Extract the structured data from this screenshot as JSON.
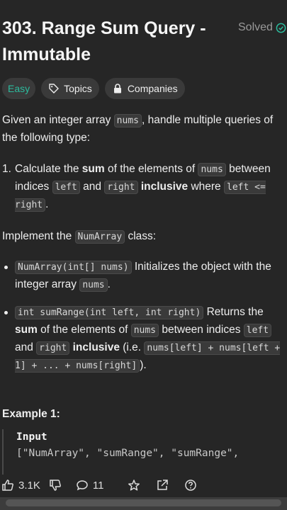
{
  "problem": {
    "title": "303. Range Sum Query - Immutable",
    "status": "Solved",
    "difficulty": "Easy",
    "topics_label": "Topics",
    "companies_label": "Companies"
  },
  "description": {
    "intro_1": "Given an integer array ",
    "intro_code": "nums",
    "intro_2": ", handle multiple queries of the following type:",
    "item1": {
      "num": "1.",
      "t1": "Calculate the ",
      "b1": "sum",
      "t2": " of the elements of ",
      "c1": "nums",
      "t3": " between indices ",
      "c2": "left",
      "t4": " and ",
      "c3": "right",
      "t5": " ",
      "b2": "inclusive",
      "t6": " where ",
      "c4": "left <= right",
      "t7": "."
    },
    "impl_1": "Implement the ",
    "impl_code": "NumArray",
    "impl_2": " class:",
    "bullet1": {
      "c1": "NumArray(int[] nums)",
      "t1": " Initializes the object with the integer array ",
      "c2": "nums",
      "t2": "."
    },
    "bullet2": {
      "c1": "int sumRange(int left, int right)",
      "t1": " Returns the ",
      "b1": "sum",
      "t2": " of the elements of ",
      "c2": "nums",
      "t3": " between indices ",
      "c3": "left",
      "t4": " and ",
      "c4": "right",
      "t5": " ",
      "b2": "inclusive",
      "t6": " (i.e. ",
      "c5": "nums[left] + nums[left + 1] + ... + nums[right]",
      "t7": ")."
    }
  },
  "example": {
    "heading": "Example 1:",
    "input_label": "Input",
    "input_value": "[\"NumArray\", \"sumRange\", \"sumRange\","
  },
  "footer": {
    "likes": "3.1K",
    "comments": "11"
  }
}
